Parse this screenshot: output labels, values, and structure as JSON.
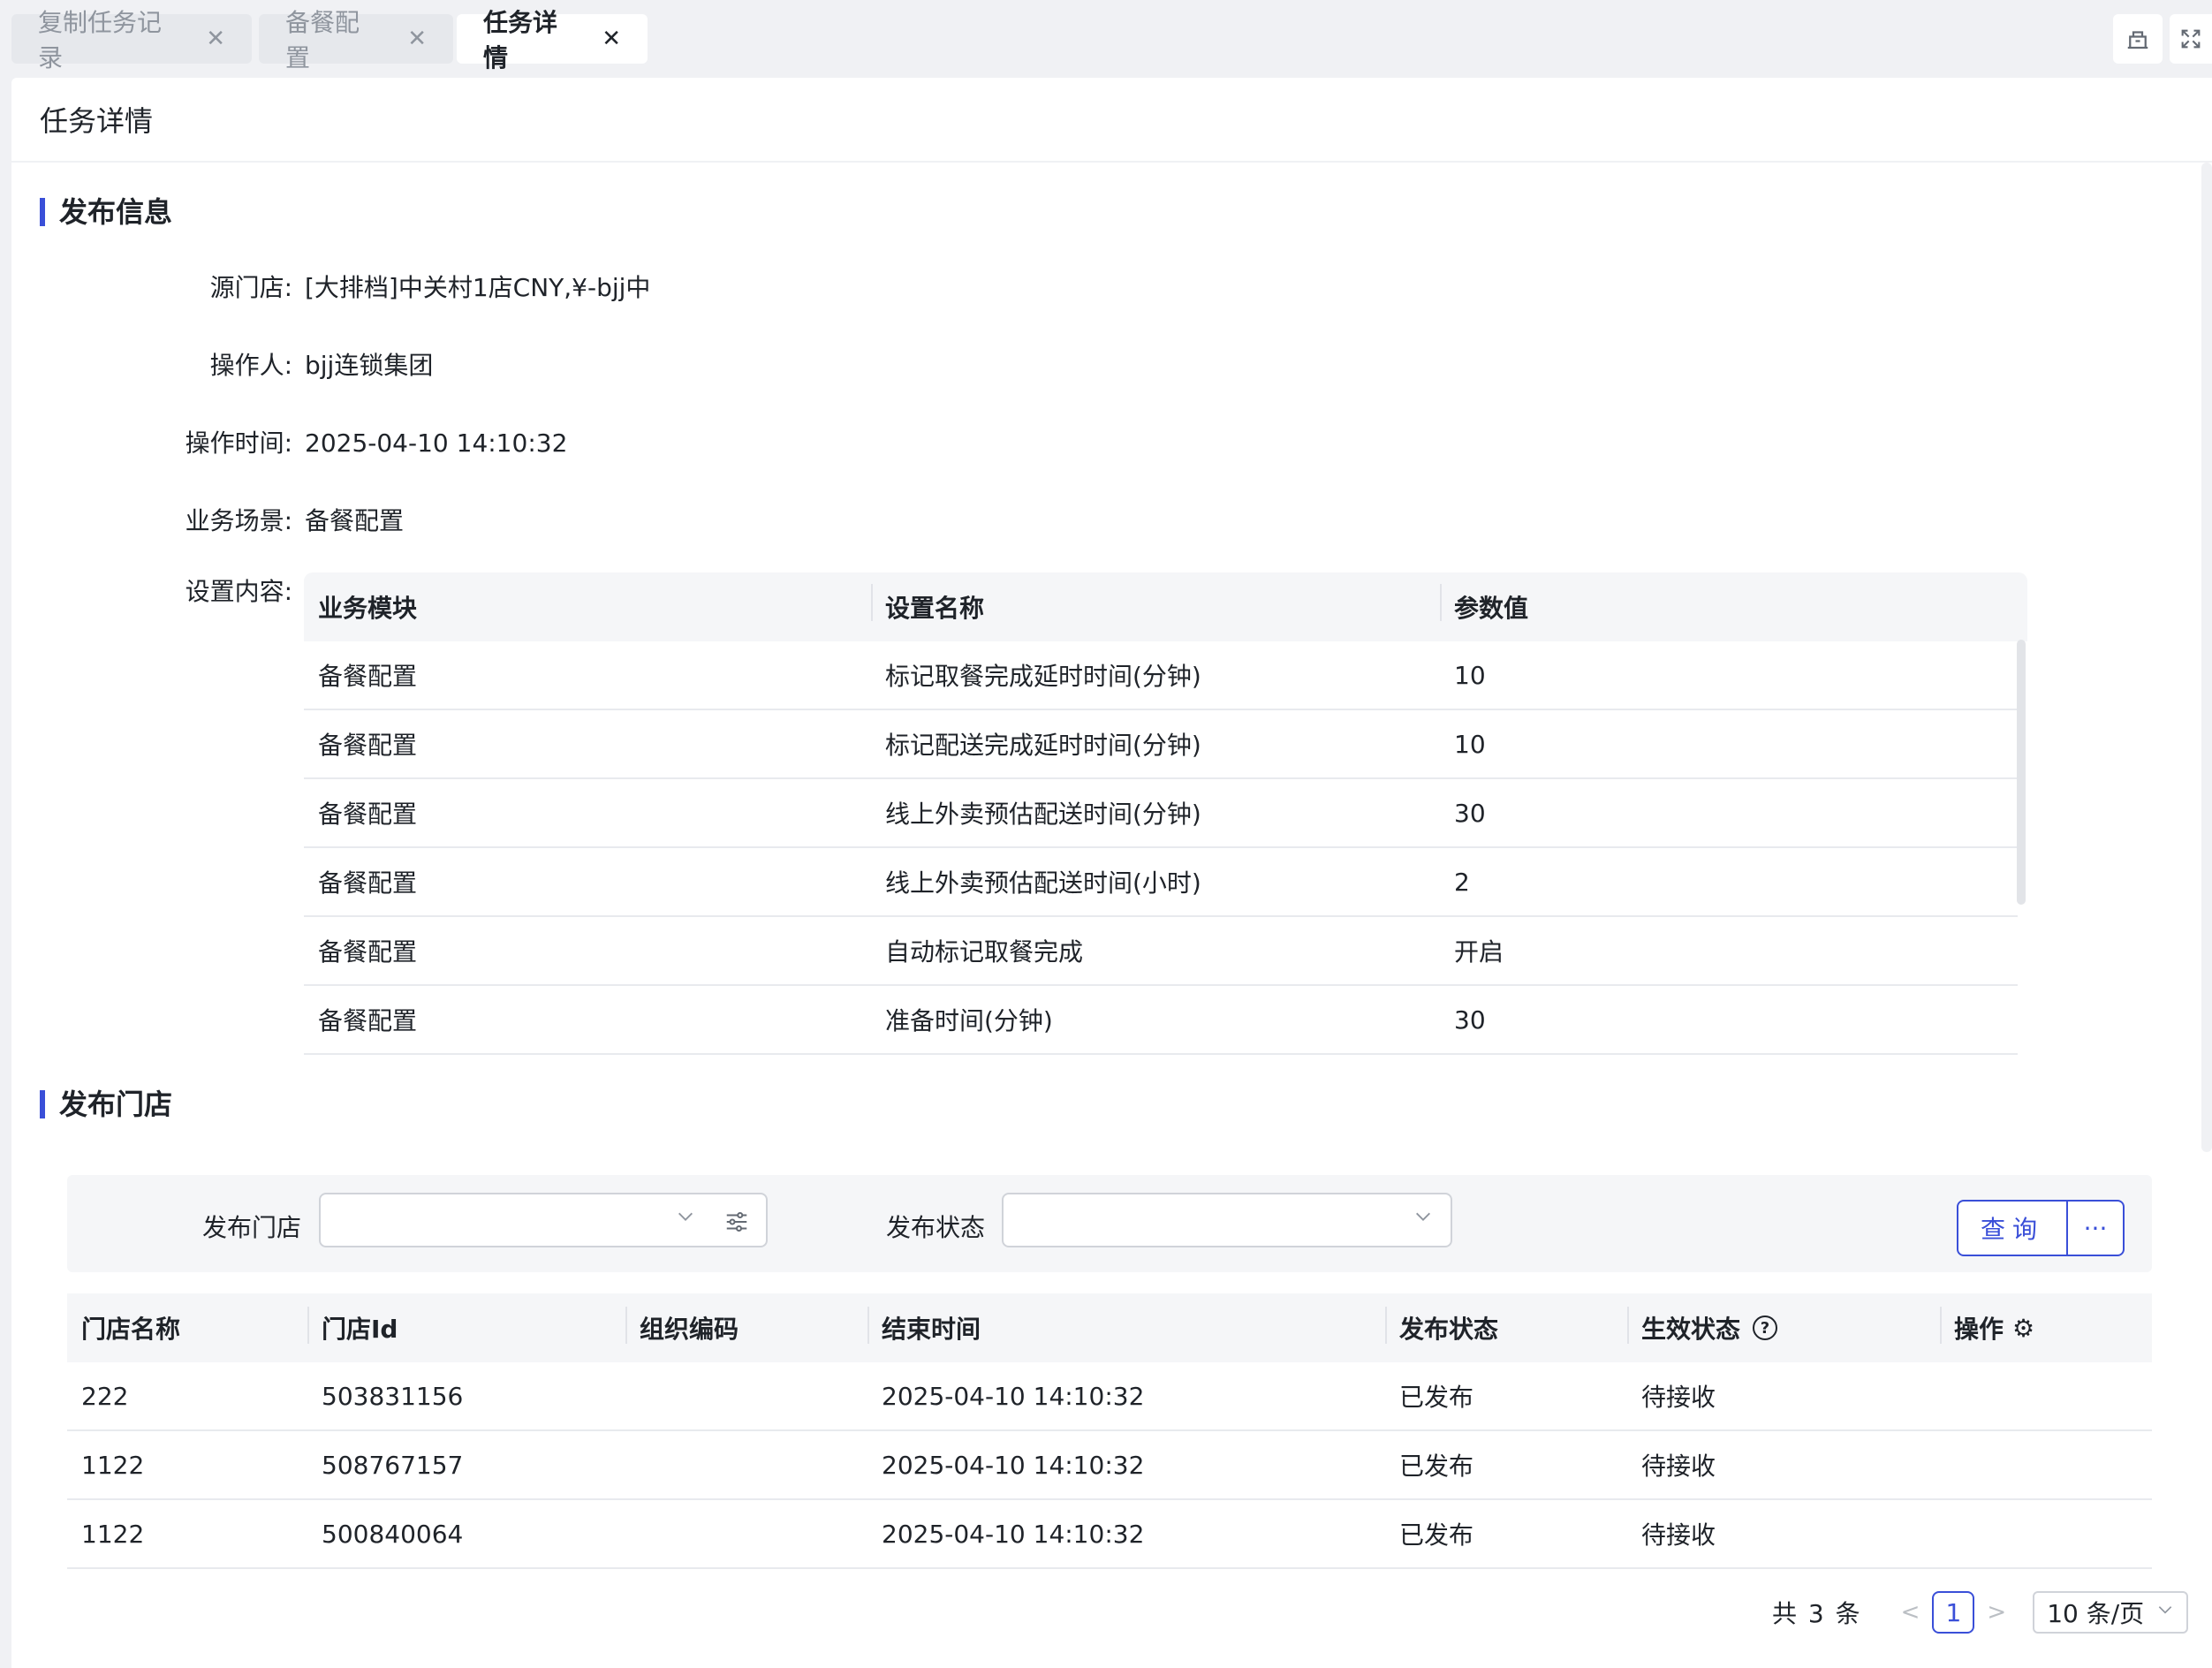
{
  "tabs": [
    {
      "label": "复制任务记录",
      "active": false
    },
    {
      "label": "备餐配置",
      "active": false
    },
    {
      "label": "任务详情",
      "active": true
    }
  ],
  "page_title": "任务详情",
  "publish_info": {
    "section_title": "发布信息",
    "source_store_label": "源门店:",
    "source_store_value": "[大排档]中关村1店CNY,¥-bjj中",
    "operator_label": "操作人:",
    "operator_value": "bjj连锁集团",
    "op_time_label": "操作时间:",
    "op_time_value": "2025-04-10 14:10:32",
    "scene_label": "业务场景:",
    "scene_value": "备餐配置",
    "content_label": "设置内容:"
  },
  "settings_table": {
    "headers": [
      "业务模块",
      "设置名称",
      "参数值"
    ],
    "rows": [
      [
        "备餐配置",
        "标记取餐完成延时时间(分钟)",
        "10"
      ],
      [
        "备餐配置",
        "标记配送完成延时时间(分钟)",
        "10"
      ],
      [
        "备餐配置",
        "线上外卖预估配送时间(分钟)",
        "30"
      ],
      [
        "备餐配置",
        "线上外卖预估配送时间(小时)",
        "2"
      ],
      [
        "备餐配置",
        "自动标记取餐完成",
        "开启"
      ],
      [
        "备餐配置",
        "准备时间(分钟)",
        "30"
      ]
    ]
  },
  "publish_stores": {
    "section_title": "发布门店",
    "filter_store_label": "发布门店",
    "filter_store_value": "",
    "filter_status_label": "发布状态",
    "filter_status_value": "",
    "query_label": "查询",
    "more_label": "···"
  },
  "store_table": {
    "headers": [
      "门店名称",
      "门店Id",
      "组织编码",
      "结束时间",
      "发布状态",
      "生效状态",
      "操作"
    ],
    "rows": [
      [
        "222",
        "503831156",
        "",
        "2025-04-10 14:10:32",
        "已发布",
        "待接收",
        ""
      ],
      [
        "1122",
        "508767157",
        "",
        "2025-04-10 14:10:32",
        "已发布",
        "待接收",
        ""
      ],
      [
        "1122",
        "500840064",
        "",
        "2025-04-10 14:10:32",
        "已发布",
        "待接收",
        ""
      ]
    ]
  },
  "pagination": {
    "total_text": "共 3 条",
    "current_page": "1",
    "page_size": "10 条/页"
  },
  "colors": {
    "accent": "#3a4fd8",
    "page_bg": "#f0f1f4"
  }
}
